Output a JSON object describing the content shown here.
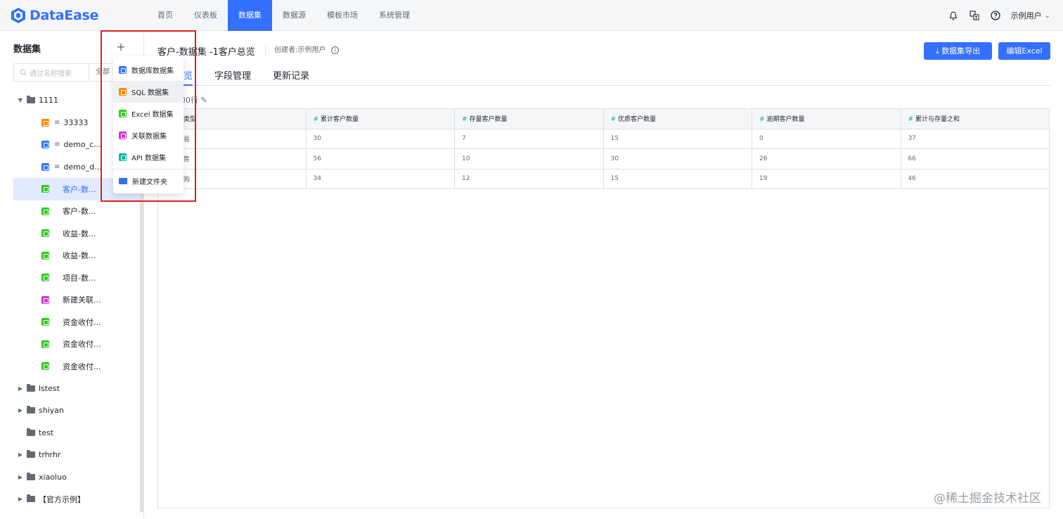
{
  "app": {
    "logo_text": "DataEase"
  },
  "nav": {
    "items": [
      {
        "label": "首页",
        "active": false
      },
      {
        "label": "仪表板",
        "active": false
      },
      {
        "label": "数据集",
        "active": true
      },
      {
        "label": "数据源",
        "active": false
      },
      {
        "label": "模板市场",
        "active": false
      },
      {
        "label": "系统管理",
        "active": false
      }
    ]
  },
  "header_right": {
    "user": "示例用户"
  },
  "sidebar": {
    "title": "数据集",
    "search_placeholder": "通过名称搜索",
    "filter": "全部",
    "tree": [
      {
        "label": "1111",
        "type": "folder",
        "expanded": true,
        "level": 0
      },
      {
        "label": "33333",
        "type": "sql",
        "color": "#ff8800",
        "level": 1
      },
      {
        "label": "demo_c...",
        "type": "sql",
        "color": "#3370ff",
        "level": 1
      },
      {
        "label": "demo_d...",
        "type": "sql",
        "color": "#3370ff",
        "level": 1
      },
      {
        "label": "客户-数...",
        "type": "excel",
        "color": "#34c724",
        "level": 1,
        "selected": true
      },
      {
        "label": "客户-数...",
        "type": "excel",
        "color": "#34c724",
        "level": 1
      },
      {
        "label": "收益-数...",
        "type": "excel",
        "color": "#34c724",
        "level": 1
      },
      {
        "label": "收益-数...",
        "type": "excel",
        "color": "#34c724",
        "level": 1
      },
      {
        "label": "项目-数...",
        "type": "excel",
        "color": "#34c724",
        "level": 1
      },
      {
        "label": "新建关联...",
        "type": "union",
        "color": "#d136d1",
        "level": 1
      },
      {
        "label": "资金收付...",
        "type": "excel",
        "color": "#34c724",
        "level": 1
      },
      {
        "label": "资金收付...",
        "type": "excel",
        "color": "#34c724",
        "level": 1
      },
      {
        "label": "资金收付...",
        "type": "excel",
        "color": "#34c724",
        "level": 1
      },
      {
        "label": "lstest",
        "type": "folder",
        "expanded": false,
        "level": 0
      },
      {
        "label": "shiyan",
        "type": "folder",
        "expanded": false,
        "level": 0
      },
      {
        "label": "test",
        "type": "folder",
        "expanded": null,
        "level": 0
      },
      {
        "label": "trhrhr",
        "type": "folder",
        "expanded": false,
        "level": 0
      },
      {
        "label": "xiaoluo",
        "type": "folder",
        "expanded": false,
        "level": 0
      },
      {
        "label": "【官方示例】",
        "type": "folder",
        "expanded": false,
        "level": 0
      }
    ]
  },
  "dropdown": {
    "items": [
      {
        "label": "数据库数据集",
        "color": "#3370ff",
        "hover": false
      },
      {
        "label": "SQL 数据集",
        "color": "#ff8800",
        "hover": true
      },
      {
        "label": "Excel 数据集",
        "color": "#34c724",
        "hover": false
      },
      {
        "label": "关联数据集",
        "color": "#d136d1",
        "hover": false
      },
      {
        "label": "API 数据集",
        "color": "#00b69b",
        "hover": false
      }
    ],
    "folder_label": "新建文件夹"
  },
  "main": {
    "title": "客户-数据集 -1客户总览",
    "creator": "创建者:示例用户",
    "export_button": "数据集导出",
    "edit_button": "编辑Excel",
    "tabs": [
      {
        "label": "览",
        "active": true
      },
      {
        "label": "字段管理",
        "active": false
      },
      {
        "label": "更新记录",
        "active": false
      }
    ],
    "row_count": "00行",
    "table": {
      "columns": [
        "类型",
        "累计客户数量",
        "存量客户数量",
        "优质客户数量",
        "逾期客户数量",
        "累计与存量之和"
      ],
      "rows": [
        [
          "易",
          "30",
          "7",
          "15",
          "0",
          "37"
        ],
        [
          "售",
          "56",
          "10",
          "30",
          "26",
          "66"
        ],
        [
          "购",
          "34",
          "12",
          "15",
          "19",
          "46"
        ]
      ]
    }
  },
  "watermark": "@稀土掘金技术社区"
}
